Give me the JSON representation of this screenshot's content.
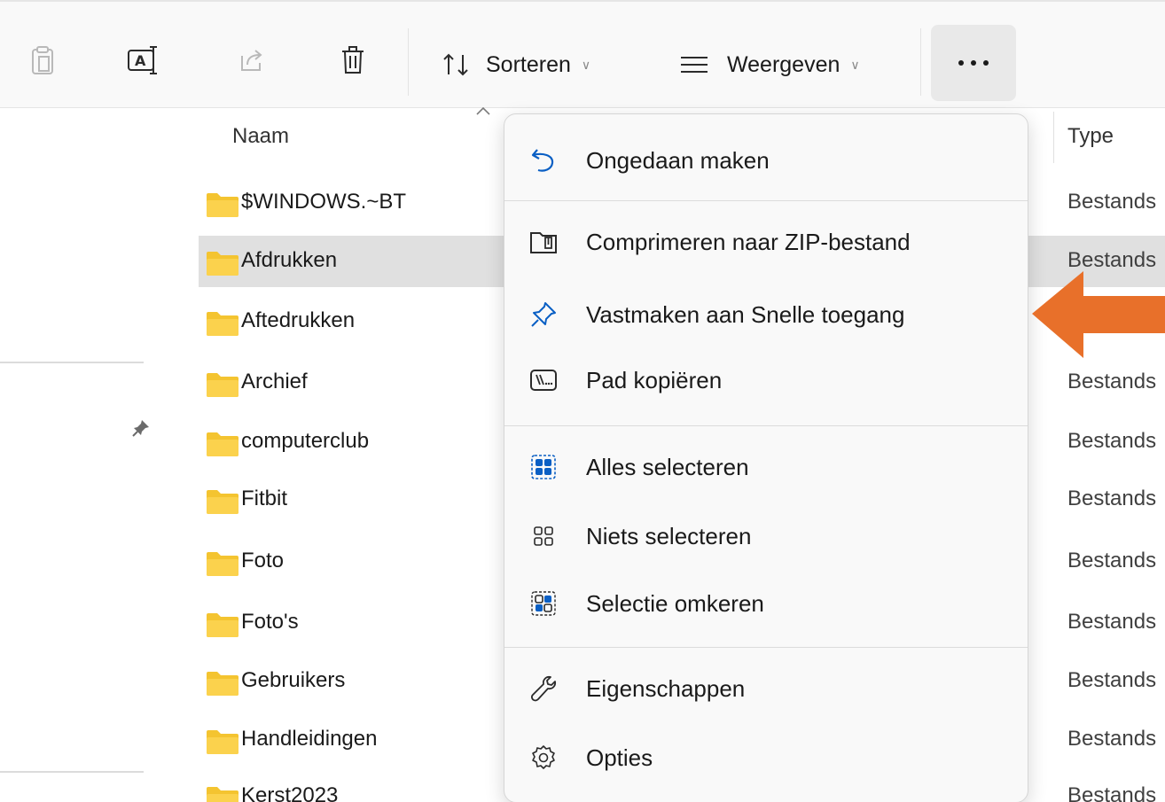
{
  "toolbar": {
    "sort_label": "Sorteren",
    "view_label": "Weergeven",
    "more_label": "..."
  },
  "list": {
    "header_name": "Naam",
    "header_type": "Type",
    "rows": [
      {
        "name": "$WINDOWS.~BT",
        "type": "Bestands"
      },
      {
        "name": "Afdrukken",
        "type": "Bestands"
      },
      {
        "name": "Aftedrukken",
        "type": ""
      },
      {
        "name": "Archief",
        "type": "Bestands"
      },
      {
        "name": "computerclub",
        "type": "Bestands"
      },
      {
        "name": "Fitbit",
        "type": "Bestands"
      },
      {
        "name": "Foto",
        "type": "Bestands"
      },
      {
        "name": "Foto's",
        "type": "Bestands"
      },
      {
        "name": "Gebruikers",
        "type": "Bestands"
      },
      {
        "name": "Handleidingen",
        "type": "Bestands"
      },
      {
        "name": "Kerst2023",
        "type": "Bestands"
      }
    ]
  },
  "context_menu": {
    "items": [
      {
        "label": "Ongedaan maken",
        "icon": "undo-icon"
      },
      {
        "label": "Comprimeren naar ZIP-bestand",
        "icon": "zip-icon"
      },
      {
        "label": "Vastmaken aan Snelle toegang",
        "icon": "pin-icon"
      },
      {
        "label": "Pad kopiëren",
        "icon": "copy-path-icon"
      },
      {
        "label": "Alles selecteren",
        "icon": "select-all-icon"
      },
      {
        "label": "Niets selecteren",
        "icon": "select-none-icon"
      },
      {
        "label": "Selectie omkeren",
        "icon": "invert-selection-icon"
      },
      {
        "label": "Eigenschappen",
        "icon": "properties-icon"
      },
      {
        "label": "Opties",
        "icon": "options-icon"
      }
    ]
  },
  "colors": {
    "accent_blue": "#0a5fc4",
    "arrow_orange": "#e8702a",
    "folder_yellow": "#f4c430",
    "selected_row": "#e0e0e0"
  }
}
